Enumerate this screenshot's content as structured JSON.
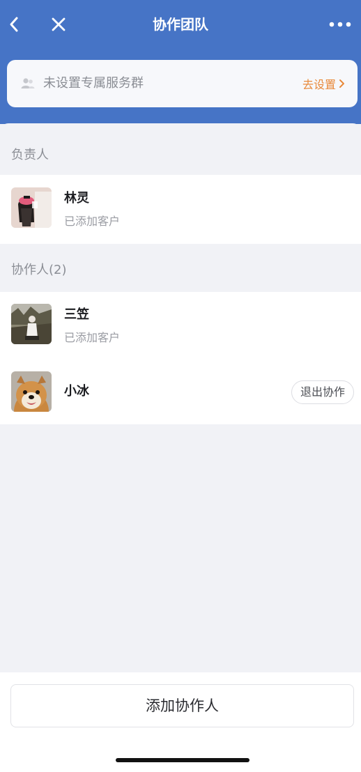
{
  "header": {
    "title": "协作团队",
    "back_icon": "chevron-left-icon",
    "close_icon": "close-icon",
    "more_icon": "more-dots-icon"
  },
  "group_banner": {
    "text": "未设置专属服务群",
    "action_label": "去设置",
    "icon": "group-people-icon"
  },
  "owner_section": {
    "label": "负责人",
    "members": [
      {
        "name": "林灵",
        "status": "已添加客户"
      }
    ]
  },
  "collaborator_section": {
    "label": "协作人(2)",
    "members": [
      {
        "name": "三笠",
        "status": "已添加客户"
      },
      {
        "name": "小冰",
        "action_label": "退出协作"
      }
    ]
  },
  "footer": {
    "add_button_label": "添加协作人"
  },
  "colors": {
    "header_bg": "#4674c6",
    "accent_orange": "#e8893a",
    "page_bg": "#f1f2f6"
  }
}
